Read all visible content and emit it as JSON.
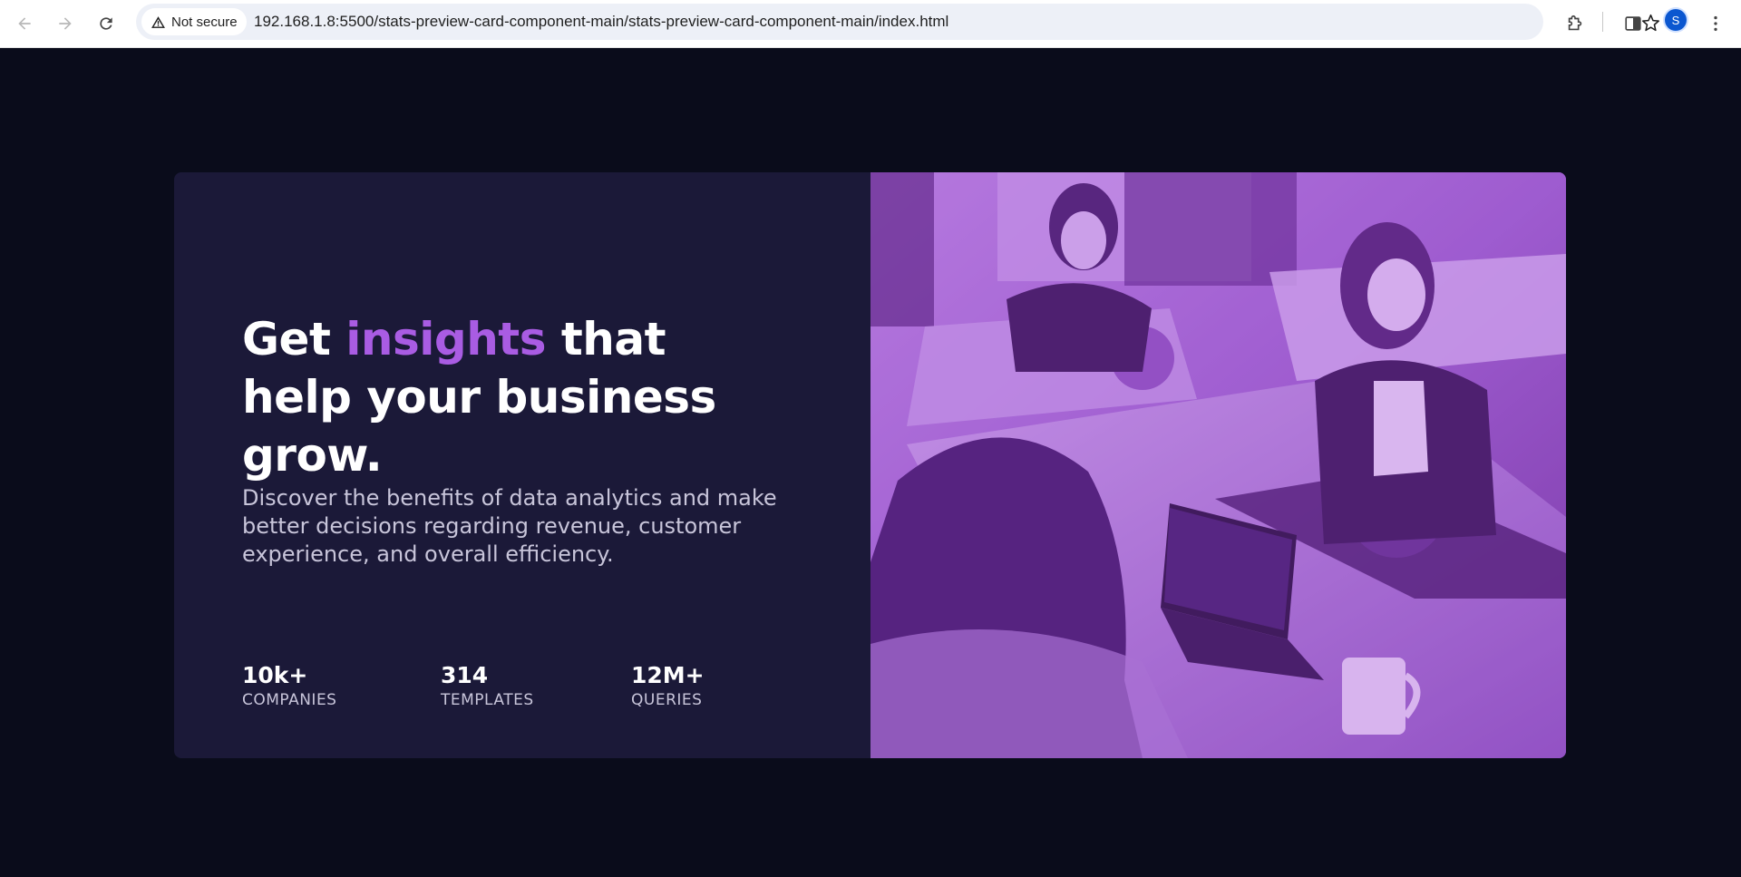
{
  "browser": {
    "security_label": "Not secure",
    "url": "192.168.1.8:5500/stats-preview-card-component-main/stats-preview-card-component-main/index.html",
    "profile_initial": "S"
  },
  "card": {
    "headline_part1": "Get ",
    "headline_accent": "insights",
    "headline_part2": " that help your business grow.",
    "description": "Discover the benefits of data analytics and make better decisions regarding revenue, customer experience, and overall efficiency.",
    "stats": [
      {
        "value": "10k+",
        "label": "COMPANIES"
      },
      {
        "value": "314",
        "label": "TEMPLATES"
      },
      {
        "value": "12M+",
        "label": "QUERIES"
      }
    ],
    "image_subject": "people working in an office"
  },
  "colors": {
    "page_background": "#0a0c1b",
    "card_background": "#1b1938",
    "accent": "#a95ce3",
    "image_tint": "#aa5cdb"
  }
}
